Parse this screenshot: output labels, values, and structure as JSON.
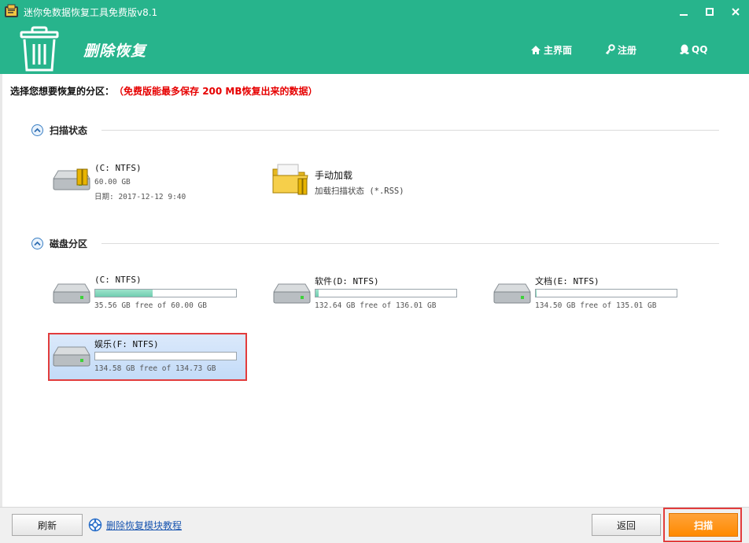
{
  "window": {
    "title": "迷你免数据恢复工具免费版v8.1",
    "min_symbol": "—",
    "close_symbol": "✕"
  },
  "header": {
    "module_title": "删除恢复",
    "nav": {
      "home": "主界面",
      "register": "注册",
      "qq": "QQ"
    },
    "colors": {
      "accent": "#27b48c"
    }
  },
  "prompt": {
    "label": "选择您想要恢复的分区：",
    "note": "（免费版能最多保存 200 MB恢复出来的数据）"
  },
  "scan_state": {
    "heading": "扫描状态",
    "items": [
      {
        "name": "(C: NTFS)",
        "size": "60.00 GB",
        "date": "日期: 2017-12-12 9:40",
        "icon": "disk-drive-icon"
      },
      {
        "name": "手动加载",
        "sub": "加载扫描状态 (*.RSS)",
        "icon": "folder-icon"
      }
    ]
  },
  "disks": {
    "heading": "磁盘分区",
    "partitions": [
      {
        "name": "(C: NTFS)",
        "free_text": "35.56 GB free of 60.00 GB",
        "used_fraction": 0.41
      },
      {
        "name": "软件(D: NTFS)",
        "free_text": "132.64 GB free of 136.01 GB",
        "used_fraction": 0.025
      },
      {
        "name": "文档(E: NTFS)",
        "free_text": "134.50 GB free of 135.01 GB",
        "used_fraction": 0.004
      },
      {
        "name": "娱乐(F: NTFS)",
        "free_text": "134.58 GB free of 134.73 GB",
        "used_fraction": 0.001,
        "selected": true
      }
    ]
  },
  "footer": {
    "refresh": "刷新",
    "tutorial": "删除恢复模块教程",
    "back": "返回",
    "scan": "扫描",
    "colors": {
      "scan_button": "#ff8a00",
      "highlight": "#e23c3c"
    }
  }
}
